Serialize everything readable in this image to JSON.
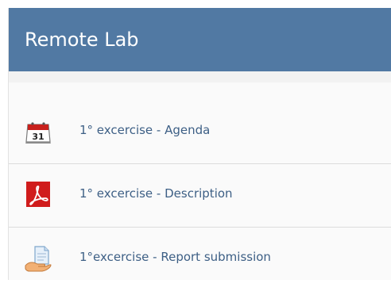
{
  "header": {
    "title": "Remote Lab"
  },
  "items": [
    {
      "label": "1° excercise - Agenda",
      "icon": "calendar-icon",
      "calendar_day": "31"
    },
    {
      "label": "1° excercise - Description",
      "icon": "pdf-icon"
    },
    {
      "label": "1°excercise - Report submission",
      "icon": "document-hand-icon"
    }
  ],
  "colors": {
    "header_bg": "#5179a3",
    "link": "#3d5f85",
    "pdf_red": "#d01c1c"
  }
}
